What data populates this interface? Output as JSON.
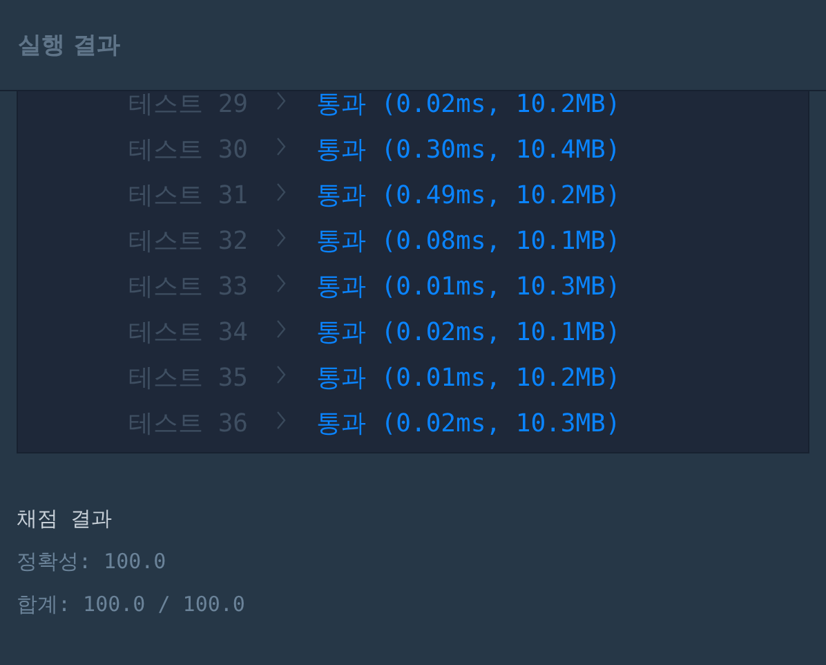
{
  "panel": {
    "title": "실행 결과"
  },
  "tests": [
    {
      "label": "테스트 29",
      "result": "통과 (0.02ms, 10.2MB)"
    },
    {
      "label": "테스트 30",
      "result": "통과 (0.30ms, 10.4MB)"
    },
    {
      "label": "테스트 31",
      "result": "통과 (0.49ms, 10.2MB)"
    },
    {
      "label": "테스트 32",
      "result": "통과 (0.08ms, 10.1MB)"
    },
    {
      "label": "테스트 33",
      "result": "통과 (0.01ms, 10.3MB)"
    },
    {
      "label": "테스트 34",
      "result": "통과 (0.02ms, 10.1MB)"
    },
    {
      "label": "테스트 35",
      "result": "통과 (0.01ms, 10.2MB)"
    },
    {
      "label": "테스트 36",
      "result": "통과 (0.02ms, 10.3MB)"
    }
  ],
  "grading": {
    "title": "채점 결과",
    "lines": [
      "정확성: 100.0",
      "합계: 100.0 / 100.0"
    ]
  }
}
